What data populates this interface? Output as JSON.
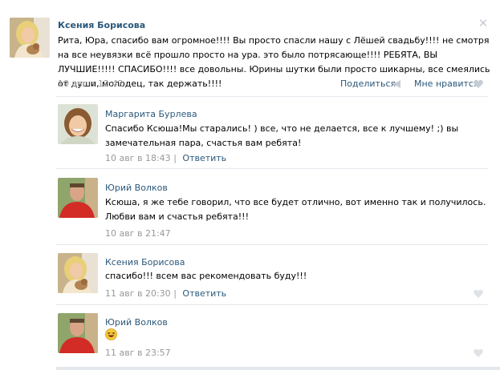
{
  "post": {
    "author": "Ксения Борисова",
    "text": "Рита, Юра, спасибо вам огромное!!!! Вы просто спасли нашу с Лёшей свадьбу!!!! не смотря на все неувязки всё прошло просто на ура. это было потрясающе!!!! РЕБЯТА, ВЫ ЛУЧШИЕ!!!!! СПАСИБО!!!! все довольны. Юрины шутки были просто шикарны, все смеялись от души, молодец, так держать!!!!",
    "date": "10 авг в 12:42",
    "share_label": "Поделиться",
    "like_label": "Мне нравится"
  },
  "replies": [
    {
      "author": "Маргарита Бурлева",
      "text": "Спасибо Ксюша!Мы старались! ) все, что не делается, все к лучшему! ;) вы замечательная пара, счастья вам ребята!",
      "date": "10 авг в 18:43",
      "sep": "|",
      "answer": "Ответить"
    },
    {
      "author": "Юрий Волков",
      "text": "Ксюша, я же тебе говорил, что все будет отлично, вот именно так и получилось. Любви вам и счастья ребята!!!",
      "date": "10 авг в 21:47"
    },
    {
      "author": "Ксения Борисова",
      "text": "спасибо!!! всем вас рекомендовать буду!!!",
      "date": "11 авг в 20:30",
      "sep": "|",
      "answer": "Ответить"
    },
    {
      "author": "Юрий Волков",
      "date": "11 авг в 23:57"
    }
  ],
  "icons": {
    "close": "close-icon",
    "share": "megaphone-icon",
    "like": "heart-icon",
    "emoji": "laughing-smiley-icon"
  },
  "colors": {
    "link": "#2b587a",
    "meta": "#999999",
    "separator": "#e4e8ed",
    "heart": "#c6ccd3"
  }
}
